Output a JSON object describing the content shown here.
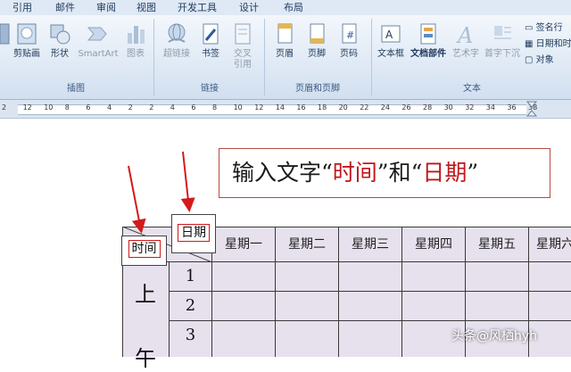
{
  "tabs": [
    "引用",
    "邮件",
    "审阅",
    "视图",
    "开发工具",
    "设计",
    "布局"
  ],
  "ribbon": {
    "illustrations": {
      "items": [
        "剪贴画",
        "形状",
        "SmartArt",
        "图表"
      ],
      "label": "插图"
    },
    "links": {
      "items": [
        "超链接",
        "书签",
        "交叉\n引用"
      ],
      "label": "链接"
    },
    "header_footer": {
      "items": [
        "页眉",
        "页脚",
        "页码"
      ],
      "label": "页眉和页脚"
    },
    "text": {
      "items": [
        "文本框",
        "文档部件",
        "艺术字",
        "首字下沉"
      ],
      "small": [
        "签名行",
        "日期和时",
        "对象"
      ],
      "label": "文本"
    }
  },
  "ruler": {
    "numbers": [
      "2",
      "12",
      "10",
      "8",
      "6",
      "4",
      "2",
      "2",
      "4",
      "6",
      "8",
      "10",
      "12",
      "14",
      "16",
      "18",
      "20",
      "22",
      "24",
      "26",
      "28",
      "30",
      "32",
      "34",
      "36",
      "38"
    ]
  },
  "callout": {
    "prefix": "输入文字“",
    "word1": "时间",
    "middle": "”和“",
    "word2": "日期",
    "suffix": "”"
  },
  "table": {
    "time_tag": "时间",
    "date_tag": "日期",
    "headers": [
      "星期一",
      "星期二",
      "星期三",
      "星期四",
      "星期五",
      "星期六"
    ],
    "rows": [
      "1",
      "2",
      "3"
    ],
    "side_chars": [
      "上",
      "午"
    ]
  },
  "watermark": "头条@风栖hyh",
  "colors": {
    "arrow": "#d41a1a",
    "callout_border": "#b84a44",
    "highlight": "#c0171c",
    "table_fill": "#e7e1ee"
  }
}
